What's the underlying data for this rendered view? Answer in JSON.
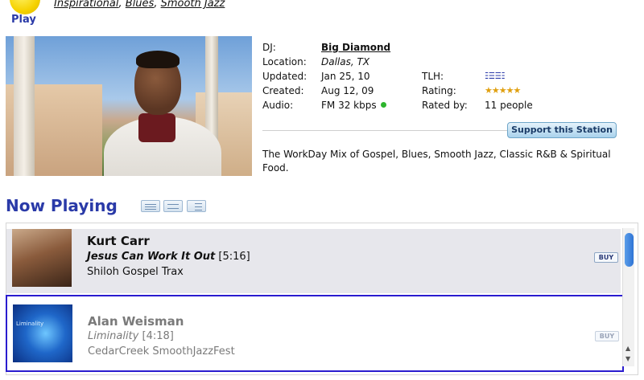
{
  "header": {
    "play_label": "Play",
    "genres": [
      "Inspirational",
      "Blues",
      "Smooth Jazz"
    ]
  },
  "station": {
    "dj_label": "DJ:",
    "dj_value": "Big Diamond",
    "location_label": "Location:",
    "location_value": "Dallas, TX",
    "updated_label": "Updated:",
    "updated_value": "Jan 25, 10",
    "created_label": "Created:",
    "created_value": "Aug 12, 09",
    "audio_label": "Audio:",
    "audio_value": "FM 32 kbps",
    "tlh_label": "TLH:",
    "tlh_icons": "☷☷☷",
    "rating_label": "Rating:",
    "rating_stars": "★★★★★",
    "rating_value": 4.5,
    "rated_by_label": "Rated by:",
    "rated_by_value": "11 people",
    "support_button": "Support this Station",
    "description": "The WorkDay Mix of Gospel, Blues, Smooth Jazz, Classic R&B & Spiritual Food."
  },
  "now_playing": {
    "title": "Now Playing",
    "tracks": [
      {
        "artist": "Kurt Carr",
        "song": "Jesus Can Work It Out",
        "duration": "[5:16]",
        "album": "Shiloh Gospel Trax",
        "buy_label": "BUY"
      },
      {
        "artist": "Alan Weisman",
        "song": "Liminality",
        "duration": "[4:18]",
        "album": "CedarCreek SmoothJazzFest",
        "buy_label": "BUY",
        "cover_text": "Liminality"
      }
    ]
  },
  "colors": {
    "accent": "#2a3aa8",
    "selection_border": "#2a1ccf",
    "online_dot": "#2db52d"
  }
}
